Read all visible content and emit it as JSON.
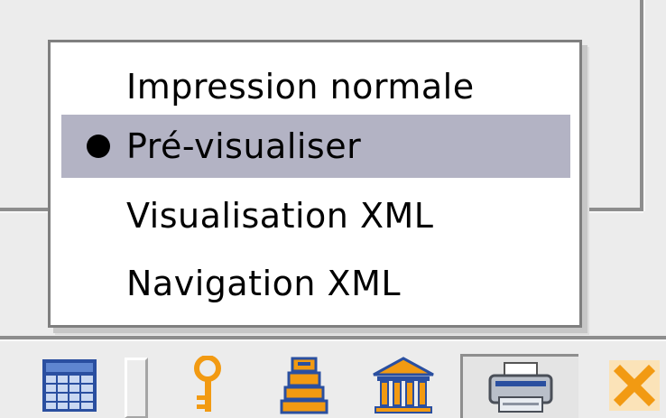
{
  "menu": {
    "items": [
      {
        "label": "Impression normale",
        "selected": false
      },
      {
        "label": "Pré-visualiser",
        "selected": true
      },
      {
        "label": "Visualisation XML",
        "selected": false
      },
      {
        "label": "Navigation XML",
        "selected": false
      }
    ],
    "selected_color": "#b3b3c4"
  },
  "toolbar": {
    "icons": [
      "calendar-grid-icon",
      "key-icon",
      "stacked-books-icon",
      "library-building-icon",
      "printer-icon",
      "close-x-icon"
    ],
    "accent_orange": "#f29a12"
  }
}
